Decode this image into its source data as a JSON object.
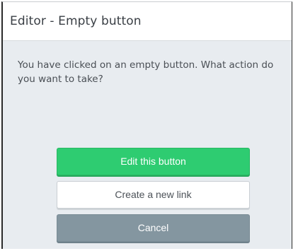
{
  "dialog": {
    "title": "Editor - Empty button",
    "message": "You have clicked on an empty button. What action do you want to take?"
  },
  "actions": {
    "edit_label": "Edit this button",
    "create_label": "Create a new link",
    "cancel_label": "Cancel"
  },
  "colors": {
    "primary": "#2ecc71",
    "secondary": "#8496a0",
    "body_bg": "#e8ecf0"
  }
}
